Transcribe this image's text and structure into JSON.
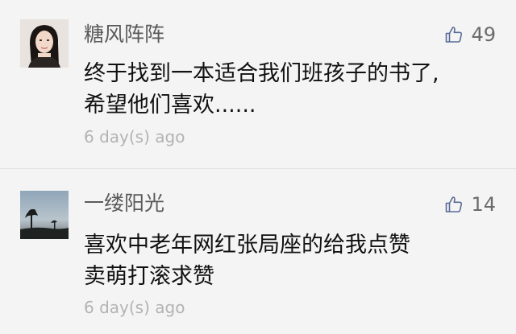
{
  "comments": [
    {
      "username": "糖风阵阵",
      "likes": "49",
      "content_lines": [
        "终于找到一本适合我们班孩子的书了,",
        "希望他们喜欢......"
      ],
      "time": "6 day(s) ago",
      "avatar": "woman-portrait-avatar"
    },
    {
      "username": "一缕阳光",
      "likes": "14",
      "content_lines": [
        "喜欢中老年网红张局座的给我点赞",
        "卖萌打滚求赞"
      ],
      "time": "6 day(s) ago",
      "avatar": "tree-silhouette-sky-avatar"
    }
  ],
  "colors": {
    "background": "#f4f4f4",
    "like_icon": "#576b95",
    "username": "#5a5a5a",
    "time": "#b3b3b3"
  },
  "icons": {
    "like": "thumbs-up-icon"
  }
}
